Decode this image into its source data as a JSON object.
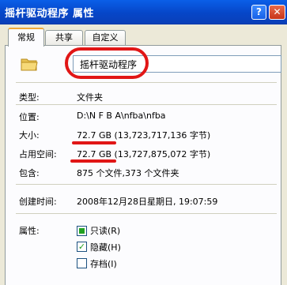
{
  "window": {
    "title": "摇杆驱动程序 属性",
    "help_glyph": "?",
    "close_glyph": "✕"
  },
  "tabs": [
    {
      "label": "常规"
    },
    {
      "label": "共享"
    },
    {
      "label": "自定义"
    }
  ],
  "general": {
    "icon": "folder-icon",
    "name": "摇杆驱动程序",
    "type_label": "类型:",
    "type_value": "文件夹",
    "location_label": "位置:",
    "location_value": "D:\\N F B A\\nfba\\nfba",
    "size_label": "大小:",
    "size_value": "72.7 GB (13,723,717,136 字节)",
    "size_on_disk_label": "占用空间:",
    "size_on_disk_value": "72.7 GB (13,727,875,072 字节)",
    "contains_label": "包含:",
    "contains_value": "875 个文件,373 个文件夹",
    "created_label": "创建时间:",
    "created_value": "2008年12月28日星期日, 19:07:59",
    "attributes_label": "属性:",
    "attributes": [
      {
        "label": "只读(R)",
        "state": "indeterminate"
      },
      {
        "label": "隐藏(H)",
        "state": "checked"
      },
      {
        "label": "存档(I)",
        "state": "unchecked"
      }
    ]
  },
  "colors": {
    "annotation_red": "#e11616",
    "titlebar_blue": "#0646c8",
    "checkbox_green": "#21a121"
  }
}
